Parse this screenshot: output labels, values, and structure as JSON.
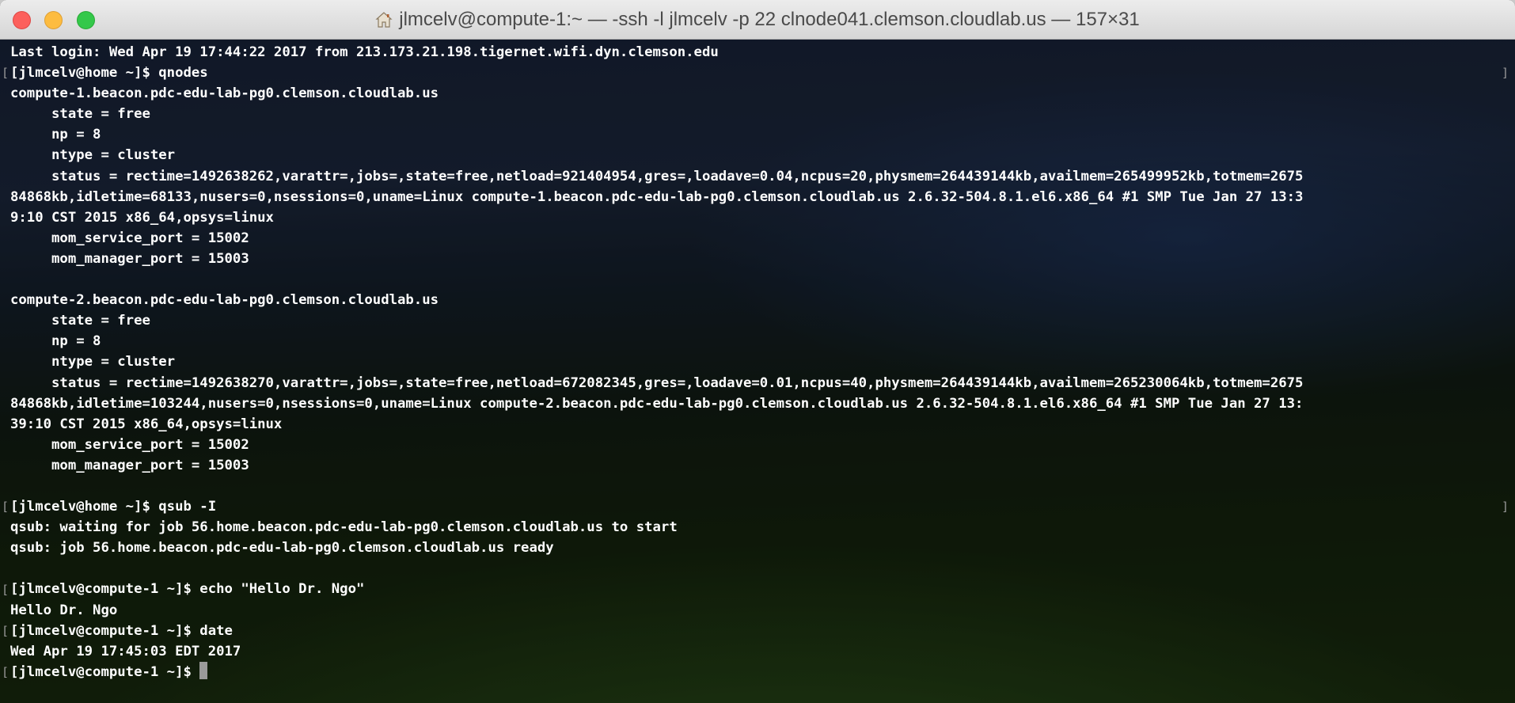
{
  "window": {
    "title": "jlmcelv@compute-1:~ — -ssh -l jlmcelv -p 22 clnode041.clemson.cloudlab.us — 157×31",
    "home_icon": "house-icon",
    "buttons": {
      "close": "close-button",
      "minimize": "minimize-button",
      "zoom": "zoom-button"
    }
  },
  "terminal": {
    "lines": [
      "Last login: Wed Apr 19 17:44:22 2017 from 213.173.21.198.tigernet.wifi.dyn.clemson.edu",
      "[jlmcelv@home ~]$ qnodes",
      "compute-1.beacon.pdc-edu-lab-pg0.clemson.cloudlab.us",
      "     state = free",
      "     np = 8",
      "     ntype = cluster",
      "     status = rectime=1492638262,varattr=,jobs=,state=free,netload=921404954,gres=,loadave=0.04,ncpus=20,physmem=264439144kb,availmem=265499952kb,totmem=2675",
      "84868kb,idletime=68133,nusers=0,nsessions=0,uname=Linux compute-1.beacon.pdc-edu-lab-pg0.clemson.cloudlab.us 2.6.32-504.8.1.el6.x86_64 #1 SMP Tue Jan 27 13:3",
      "9:10 CST 2015 x86_64,opsys=linux",
      "     mom_service_port = 15002",
      "     mom_manager_port = 15003",
      "",
      "compute-2.beacon.pdc-edu-lab-pg0.clemson.cloudlab.us",
      "     state = free",
      "     np = 8",
      "     ntype = cluster",
      "     status = rectime=1492638270,varattr=,jobs=,state=free,netload=672082345,gres=,loadave=0.01,ncpus=40,physmem=264439144kb,availmem=265230064kb,totmem=2675",
      "84868kb,idletime=103244,nusers=0,nsessions=0,uname=Linux compute-2.beacon.pdc-edu-lab-pg0.clemson.cloudlab.us 2.6.32-504.8.1.el6.x86_64 #1 SMP Tue Jan 27 13:",
      "39:10 CST 2015 x86_64,opsys=linux",
      "     mom_service_port = 15002",
      "     mom_manager_port = 15003",
      "",
      "[jlmcelv@home ~]$ qsub -I",
      "qsub: waiting for job 56.home.beacon.pdc-edu-lab-pg0.clemson.cloudlab.us to start",
      "qsub: job 56.home.beacon.pdc-edu-lab-pg0.clemson.cloudlab.us ready",
      "",
      "[jlmcelv@compute-1 ~]$ echo \"Hello Dr. Ngo\"",
      "Hello Dr. Ngo",
      "[jlmcelv@compute-1 ~]$ date",
      "Wed Apr 19 17:45:03 EDT 2017",
      "[jlmcelv@compute-1 ~]$ "
    ],
    "prompt_marks": {
      "left": "[",
      "right": "]"
    }
  }
}
